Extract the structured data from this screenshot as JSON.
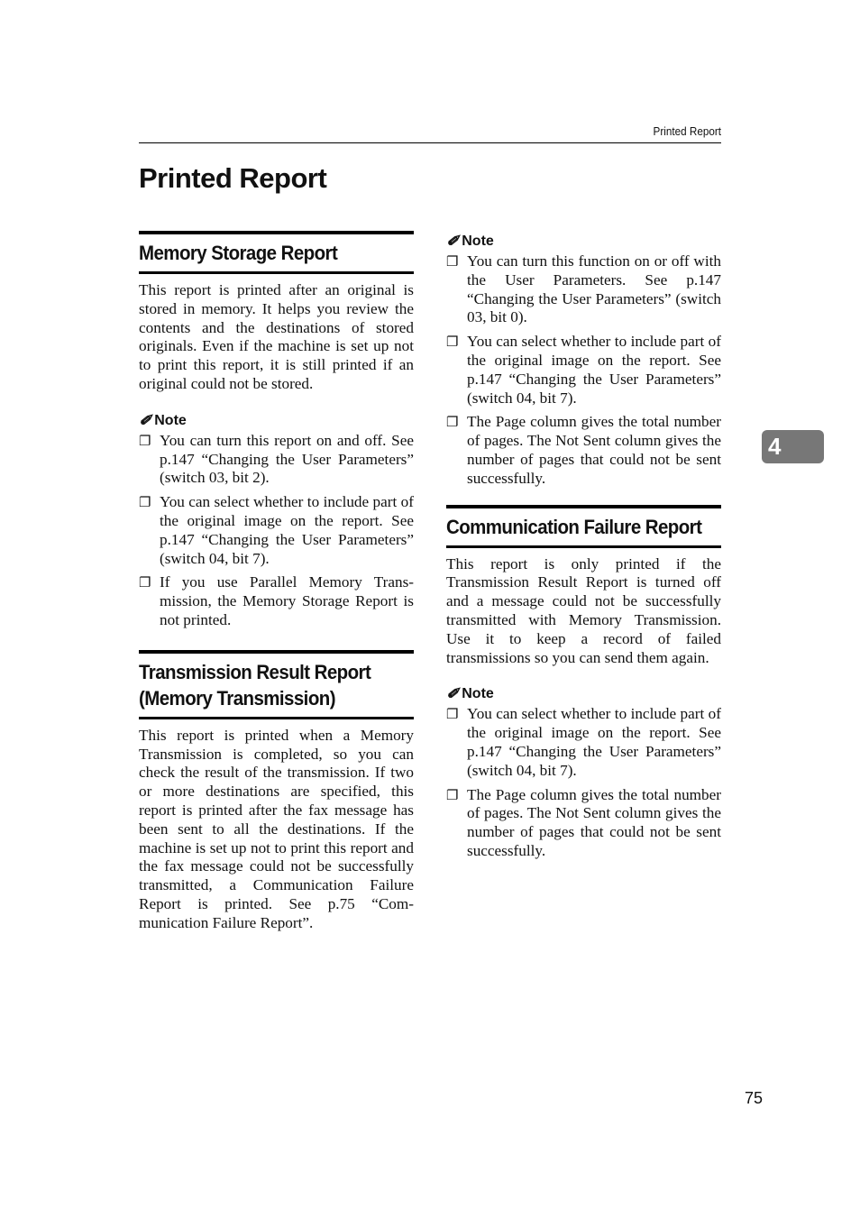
{
  "running_header": "Printed Report",
  "page_title": "Printed Report",
  "chapter_tab": "4",
  "page_number": "75",
  "note_label": "Note",
  "icons": {
    "note": "pencil-icon",
    "bullet": "checkbox-bullet-icon"
  },
  "left_column": {
    "memory_storage": {
      "heading": "Memory Storage Report",
      "body": "This report is printed after an original is stored in memory. It helps you re­view the contents and the destina­tions of stored originals. Even if the machine is set up not to print this re­port, it is still printed if an original could not be stored.",
      "notes": [
        "You can turn this report on and off. See p.147 “Changing the User Pa­rameters” (switch 03, bit 2).",
        "You can select whether to include part of the original image on the re­port. See p.147 “Changing the User Parameters” (switch 04, bit 7).",
        "If you use Parallel Memory Trans­mission, the Memory Storage Re­port is not printed."
      ]
    },
    "transmission_result": {
      "heading_line1": "Transmission Result Report",
      "heading_line2": "(Memory Transmission)",
      "body": "This report is printed when a Memo­ry Transmission is completed, so you can check the result of the transmis­sion. If two or more destinations are specified, this report is printed after the fax message has been sent to all the destinations. If the machine is set up not to print this report and the fax message could not be successfully transmitted, a Communication Fail­ure Report is printed. See p.75 “Com­munication Failure Report”."
    }
  },
  "right_column": {
    "transmission_notes": [
      "You can turn this function on or off with the User Parameters. See p.147 “Changing the User Parame­ters” (switch 03, bit 0).",
      "You can select whether to include part of the original image on the re­port. See p.147 “Changing the User Parameters” (switch 04, bit 7).",
      "The Page column gives the total number of pages. The Not Sent col­umn gives the number of pages that could not be sent successfully."
    ],
    "communication_failure": {
      "heading": "Communication Failure Report",
      "body": "This report is only printed if the Transmission Result Report is turned off and a message could not be suc­cessfully transmitted with Memory Transmission. Use it to keep a record of failed transmissions so you can send them again.",
      "notes": [
        "You can select whether to include part of the original image on the re­port. See p.147 “Changing the User Parameters” (switch 04, bit 7).",
        "The Page column gives the total number of pages. The Not Sent col­umn gives the number of pages that could not be sent successfully."
      ]
    }
  }
}
